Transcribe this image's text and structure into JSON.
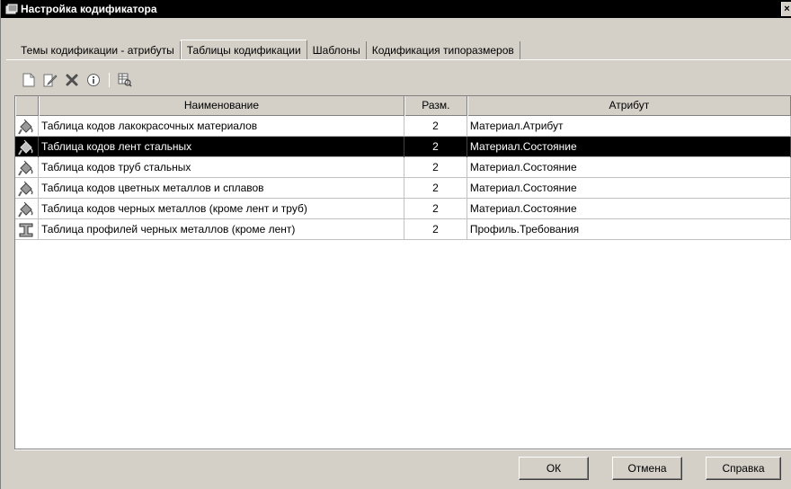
{
  "window": {
    "title": "Настройка кодификатора",
    "close_glyph": "×"
  },
  "tabs": [
    {
      "label": "Темы кодификации - атрибуты",
      "active": false
    },
    {
      "label": "Таблицы кодификации",
      "active": true
    },
    {
      "label": "Шаблоны",
      "active": false
    },
    {
      "label": "Кодификация типоразмеров",
      "active": false
    }
  ],
  "toolbar": {
    "icons": [
      "new-document-icon",
      "edit-icon",
      "delete-icon",
      "info-icon",
      "view-table-icon"
    ]
  },
  "grid": {
    "columns": [
      "Наименование",
      "Разм.",
      "Атрибут"
    ],
    "rows": [
      {
        "icon": "paint-bucket-icon",
        "name": "Таблица кодов лакокрасочных материалов",
        "size": "2",
        "attribute": "Материал.Атрибут",
        "selected": false
      },
      {
        "icon": "paint-bucket-icon",
        "name": "Таблица кодов лент стальных",
        "size": "2",
        "attribute": "Материал.Состояние",
        "selected": true
      },
      {
        "icon": "paint-bucket-icon",
        "name": "Таблица кодов труб стальных",
        "size": "2",
        "attribute": "Материал.Состояние",
        "selected": false
      },
      {
        "icon": "paint-bucket-icon",
        "name": "Таблица кодов цветных металлов и сплавов",
        "size": "2",
        "attribute": "Материал.Состояние",
        "selected": false
      },
      {
        "icon": "paint-bucket-icon",
        "name": "Таблица кодов черных металлов (кроме лент и труб)",
        "size": "2",
        "attribute": "Материал.Состояние",
        "selected": false
      },
      {
        "icon": "i-beam-icon",
        "name": "Таблица профилей черных металлов (кроме лент)",
        "size": "2",
        "attribute": "Профиль.Требования",
        "selected": false
      }
    ]
  },
  "buttons": {
    "ok": "ОК",
    "cancel": "Отмена",
    "help": "Справка"
  },
  "colors": {
    "selection": "#000000",
    "face": "#d4d0c8"
  }
}
